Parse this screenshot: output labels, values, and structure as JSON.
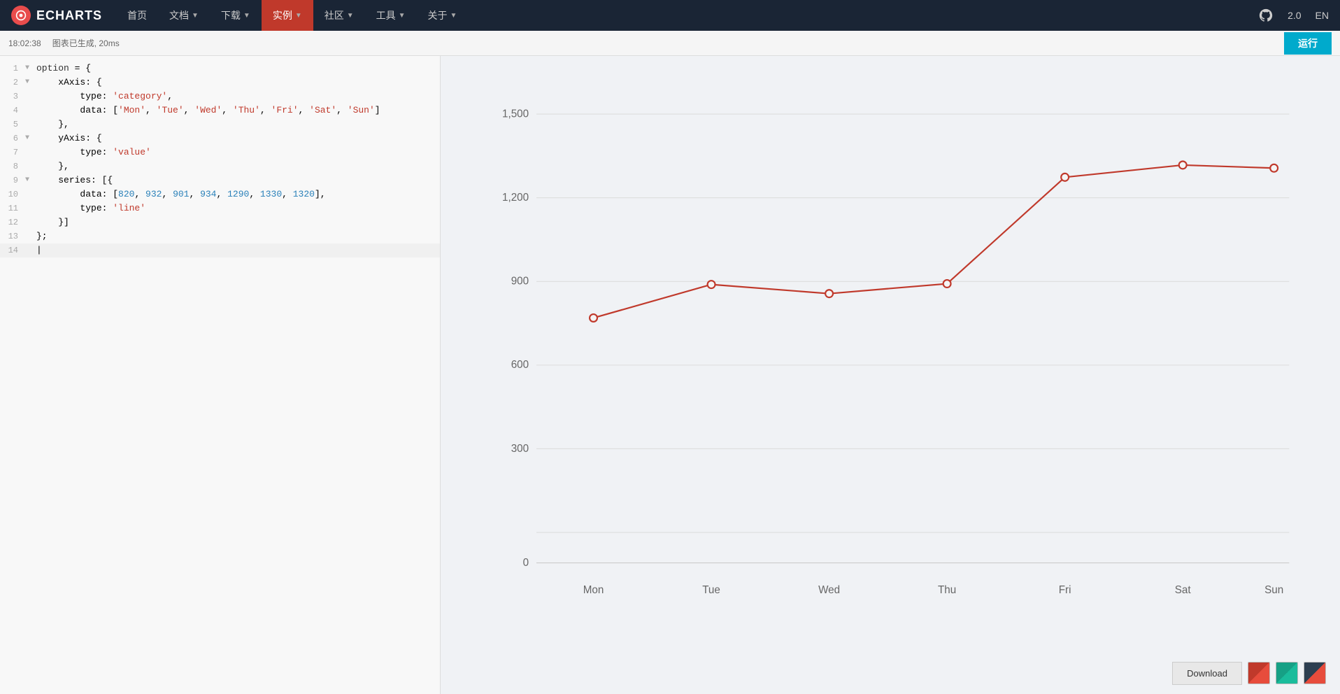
{
  "brand": {
    "name": "ECHARTS"
  },
  "navbar": {
    "items": [
      {
        "label": "首页",
        "active": false,
        "hasArrow": false
      },
      {
        "label": "文档",
        "active": false,
        "hasArrow": true
      },
      {
        "label": "下载",
        "active": false,
        "hasArrow": true
      },
      {
        "label": "实例",
        "active": true,
        "hasArrow": true
      },
      {
        "label": "社区",
        "active": false,
        "hasArrow": true
      },
      {
        "label": "工具",
        "active": false,
        "hasArrow": true
      },
      {
        "label": "关于",
        "active": false,
        "hasArrow": true
      }
    ],
    "right": {
      "version": "2.0",
      "lang": "EN"
    }
  },
  "toolbar": {
    "time": "18:02:38",
    "status": "图表已生成, 20ms",
    "run_label": "运行"
  },
  "editor": {
    "lines": [
      {
        "num": 1,
        "arrow": "▼",
        "content": "option = {"
      },
      {
        "num": 2,
        "arrow": "▼",
        "content": "    xAxis: {"
      },
      {
        "num": 3,
        "arrow": "",
        "content": "        type: 'category',"
      },
      {
        "num": 4,
        "arrow": "",
        "content": "        data: ['Mon', 'Tue', 'Wed', 'Thu', 'Fri', 'Sat', 'Sun']"
      },
      {
        "num": 5,
        "arrow": "",
        "content": "    },"
      },
      {
        "num": 6,
        "arrow": "▼",
        "content": "    yAxis: {"
      },
      {
        "num": 7,
        "arrow": "",
        "content": "        type: 'value'"
      },
      {
        "num": 8,
        "arrow": "",
        "content": "    },"
      },
      {
        "num": 9,
        "arrow": "▼",
        "content": "    series: [{"
      },
      {
        "num": 10,
        "arrow": "",
        "content": "        data: [820, 932, 901, 934, 1290, 1330, 1320],"
      },
      {
        "num": 11,
        "arrow": "",
        "content": "        type: 'line'"
      },
      {
        "num": 12,
        "arrow": "",
        "content": "    }]"
      },
      {
        "num": 13,
        "arrow": "",
        "content": "};"
      },
      {
        "num": 14,
        "arrow": "",
        "content": ""
      }
    ]
  },
  "chart": {
    "data": [
      820,
      932,
      901,
      934,
      1290,
      1330,
      1320
    ],
    "categories": [
      "Mon",
      "Tue",
      "Wed",
      "Thu",
      "Fri",
      "Sat",
      "Sun"
    ],
    "yAxis": {
      "min": 0,
      "max": 1500,
      "ticks": [
        0,
        300,
        600,
        900,
        1200,
        1500
      ]
    },
    "lineColor": "#c0392b",
    "dotColor": "#c0392b"
  },
  "footer": {
    "download_label": "Download",
    "themes": [
      {
        "name": "red-theme",
        "color": "#c0392b"
      },
      {
        "name": "teal-theme",
        "color": "#16a085"
      },
      {
        "name": "dark-theme",
        "color": "#2c3e50"
      }
    ]
  }
}
